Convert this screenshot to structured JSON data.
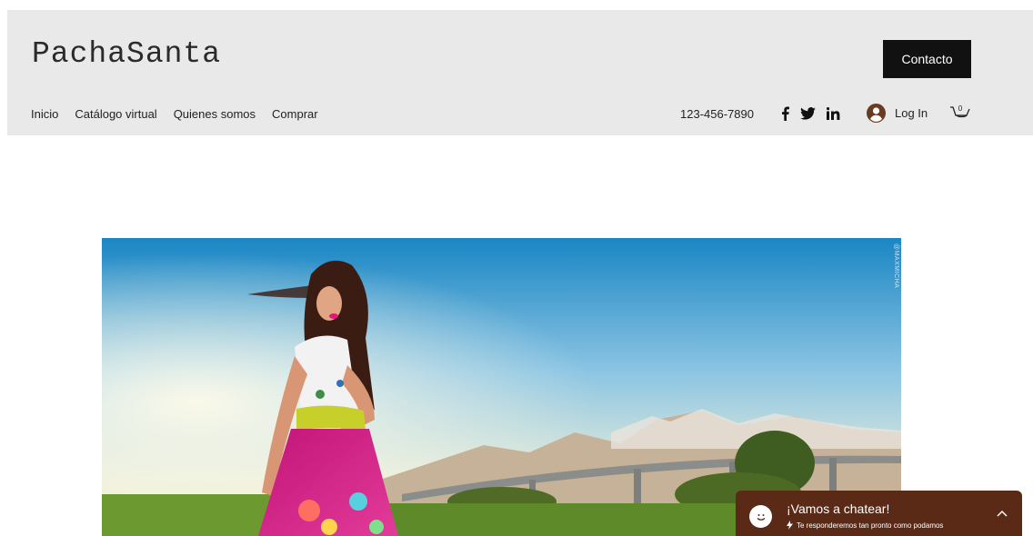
{
  "header": {
    "logo": "PachaSanta",
    "contact_label": "Contacto",
    "nav": [
      {
        "label": "Inicio"
      },
      {
        "label": "Catálogo virtual"
      },
      {
        "label": "Quienes somos"
      },
      {
        "label": "Comprar"
      }
    ],
    "phone": "123-456-7890",
    "social_icons": [
      "facebook-icon",
      "twitter-icon",
      "linkedin-icon"
    ],
    "login_label": "Log In",
    "cart_count": "0",
    "bg_color": "#e9e9e9"
  },
  "hero": {
    "watermark": "@MAXMICHA"
  },
  "chat": {
    "title": "¡Vamos a chatear!",
    "subtitle": "Te responderemos tan pronto como podamos",
    "bg_color": "#5a2a17"
  }
}
